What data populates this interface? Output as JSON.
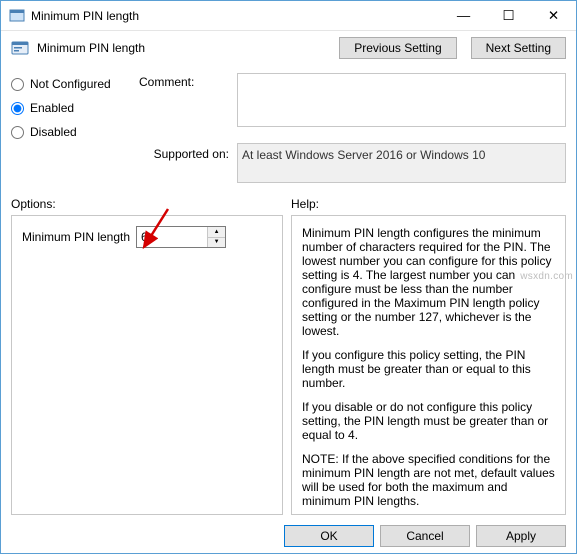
{
  "window": {
    "title": "Minimum PIN length",
    "minimize_glyph": "—",
    "maximize_glyph": "☐",
    "close_glyph": "✕"
  },
  "header": {
    "policy_title": "Minimum PIN length",
    "previous_label": "Previous Setting",
    "next_label": "Next Setting"
  },
  "state": {
    "not_configured_label": "Not Configured",
    "enabled_label": "Enabled",
    "disabled_label": "Disabled",
    "selected": "enabled"
  },
  "comment": {
    "label": "Comment:",
    "value": ""
  },
  "supported": {
    "label": "Supported on:",
    "value": "At least Windows Server 2016 or Windows 10"
  },
  "panes": {
    "options_label": "Options:",
    "help_label": "Help:"
  },
  "option": {
    "label": "Minimum PIN length",
    "value": "6"
  },
  "help": {
    "p1": "Minimum PIN length configures the minimum number of characters required for the PIN.  The lowest number you can configure for this policy setting is 4.  The largest number you can configure must be less than the number configured in the Maximum PIN length policy setting or the number 127, whichever is the lowest.",
    "p2": "If you configure this policy setting, the PIN length must be greater than or equal to this number.",
    "p3": "If you disable or do not configure this policy setting, the PIN length must be greater than or equal to 4.",
    "p4": "NOTE: If the above specified conditions for the minimum PIN length are not met, default values will be used for both the maximum and minimum PIN lengths."
  },
  "footer": {
    "ok_label": "OK",
    "cancel_label": "Cancel",
    "apply_label": "Apply"
  },
  "watermark": "wsxdn.com",
  "colors": {
    "accent": "#0078d7"
  }
}
